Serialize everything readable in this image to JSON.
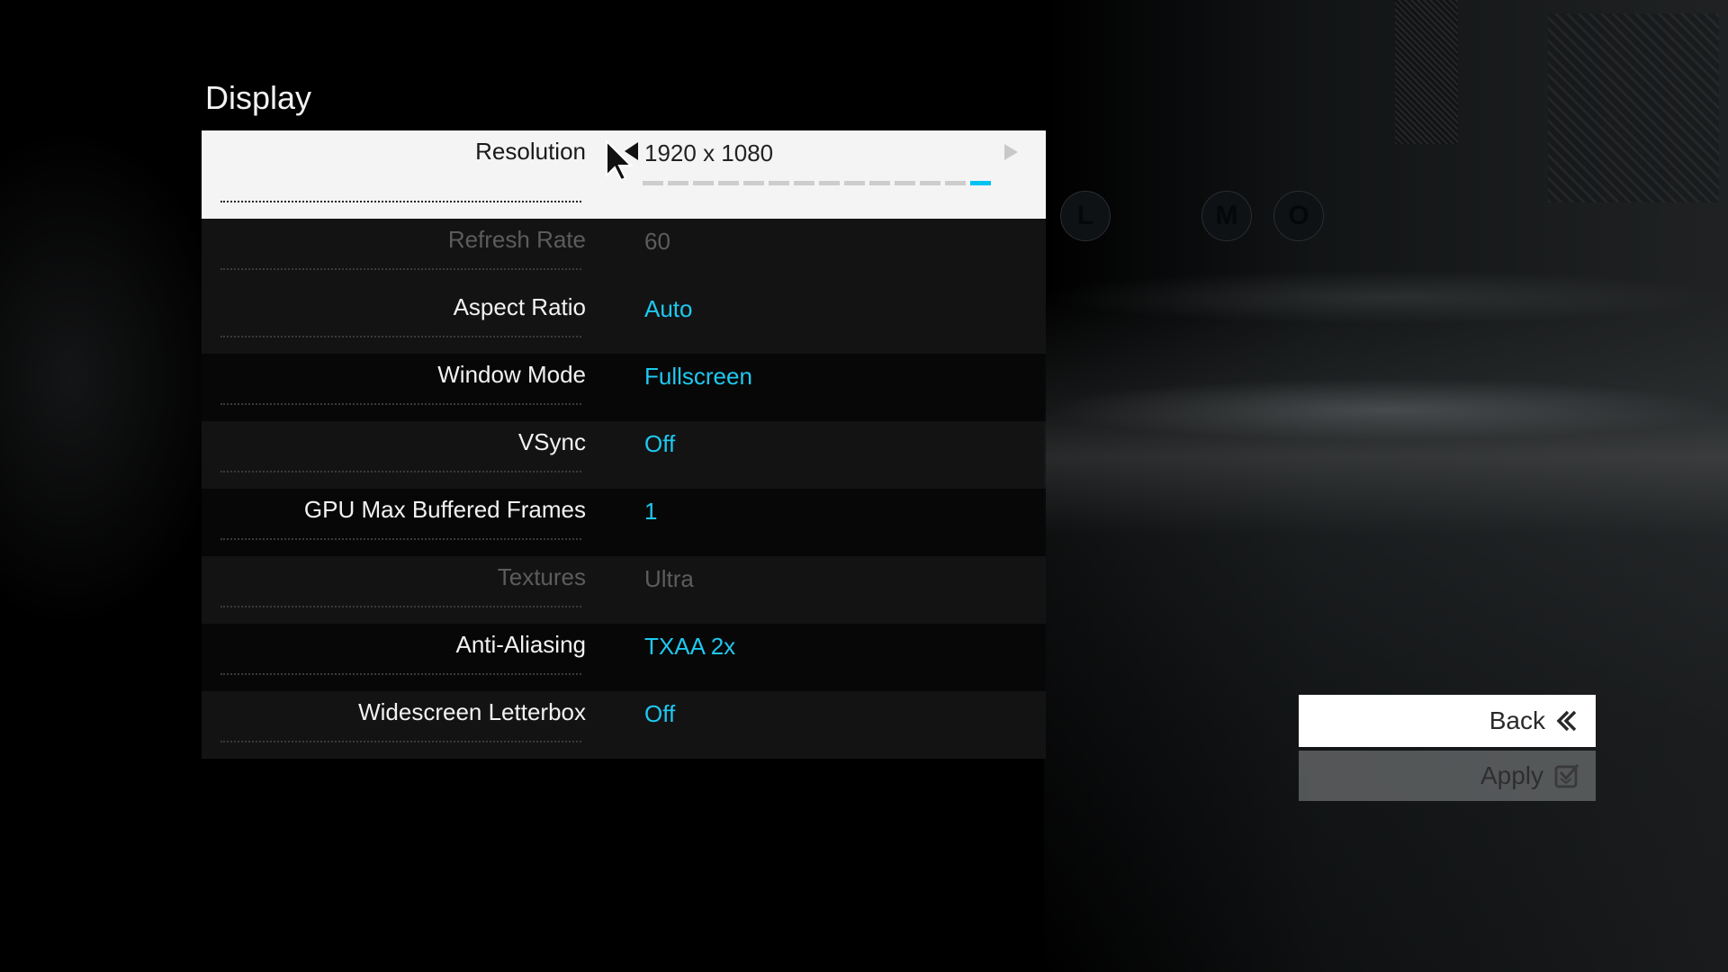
{
  "page": {
    "title": "Display"
  },
  "colors": {
    "accent": "#1ec8f0",
    "selected_row_bg": "#f4f4f4",
    "disabled_text": "#5c5c5c"
  },
  "settings": [
    {
      "label": "Resolution",
      "value": "1920 x 1080",
      "state": "selected",
      "slider": {
        "segments": 14,
        "selected_index": 14
      }
    },
    {
      "label": "Refresh Rate",
      "value": "60",
      "state": "disabled"
    },
    {
      "label": "Aspect Ratio",
      "value": "Auto",
      "state": "normal"
    },
    {
      "label": "Window Mode",
      "value": "Fullscreen",
      "state": "normal"
    },
    {
      "label": "VSync",
      "value": "Off",
      "state": "normal"
    },
    {
      "label": "GPU Max Buffered Frames",
      "value": "1",
      "state": "normal"
    },
    {
      "label": "Textures",
      "value": "Ultra",
      "state": "disabled"
    },
    {
      "label": "Anti-Aliasing",
      "value": "TXAA 2x",
      "state": "normal"
    },
    {
      "label": "Widescreen Letterbox",
      "value": "Off",
      "state": "normal"
    }
  ],
  "icons": {
    "prev": "arrow-left-icon",
    "next": "arrow-right-icon",
    "back": "double-chevron-left-icon",
    "apply": "checkbox-check-icon"
  },
  "actions": {
    "back_label": "Back",
    "apply_label": "Apply"
  }
}
